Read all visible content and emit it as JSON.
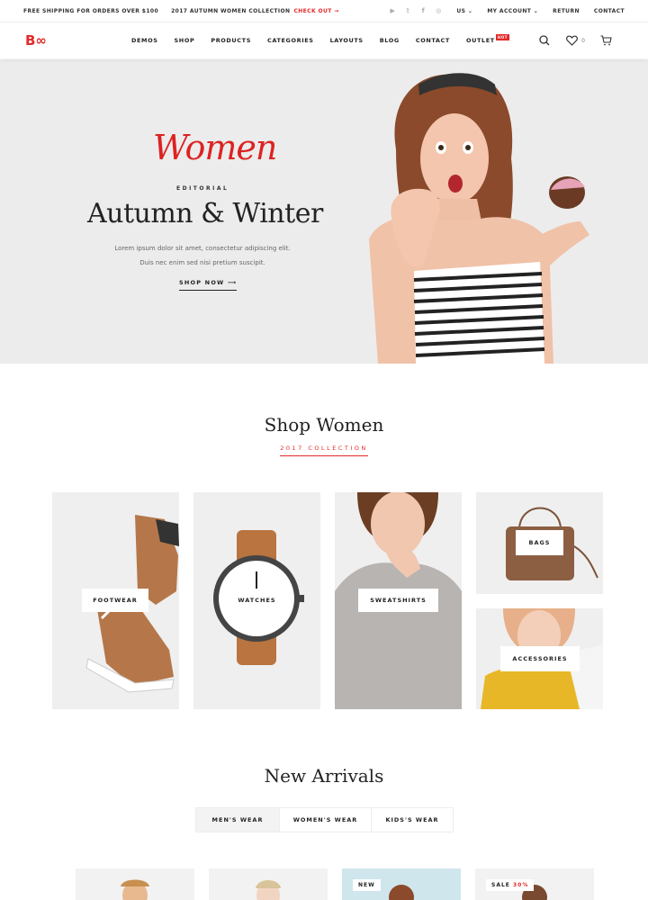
{
  "topbar": {
    "shipping": "FREE SHIPPING FOR ORDERS OVER $100",
    "collection": "2017 AUTUMN WOMEN COLLECTION",
    "checkout": "CHECK OUT →",
    "currency": "US ⌄",
    "account": "MY ACCOUNT ⌄",
    "return": "RETURN",
    "contact": "CONTACT",
    "socials": [
      "youtube-icon",
      "twitter-icon",
      "facebook-icon",
      "instagram-icon"
    ]
  },
  "header": {
    "logo": "B∞",
    "nav": [
      "DEMOS",
      "SHOP",
      "PRODUCTS",
      "CATEGORIES",
      "LAYOUTS",
      "BLOG",
      "CONTACT",
      "OUTLET"
    ],
    "outlet_badge": "HOT",
    "wishlist_count": "0"
  },
  "hero": {
    "script_title": "Women",
    "eyebrow": "EDITORIAL",
    "title": "Autumn & Winter",
    "desc_line1": "Lorem ipsum dolor sit amet, consectetur adipiscing elit.",
    "desc_line2": "Duis nec enim sed nisi pretium suscipit.",
    "cta": "SHOP NOW ⟶"
  },
  "shop_women": {
    "title": "Shop Women",
    "subtitle": "2017 COLLECTION",
    "categories": [
      "FOOTWEAR",
      "WATCHES",
      "SWEATSHIRTS",
      "BAGS",
      "ACCESSORIES"
    ]
  },
  "new_arrivals": {
    "title": "New Arrivals",
    "tabs": [
      "MEN'S WEAR",
      "WOMEN'S WEAR",
      "KIDS'S WEAR"
    ],
    "badges": {
      "new": "NEW",
      "sale": "SALE",
      "sale_pct": "30%"
    }
  },
  "colors": {
    "accent": "#e32929",
    "hero_bg": "#ececec",
    "tile_bg": "#efefef"
  }
}
